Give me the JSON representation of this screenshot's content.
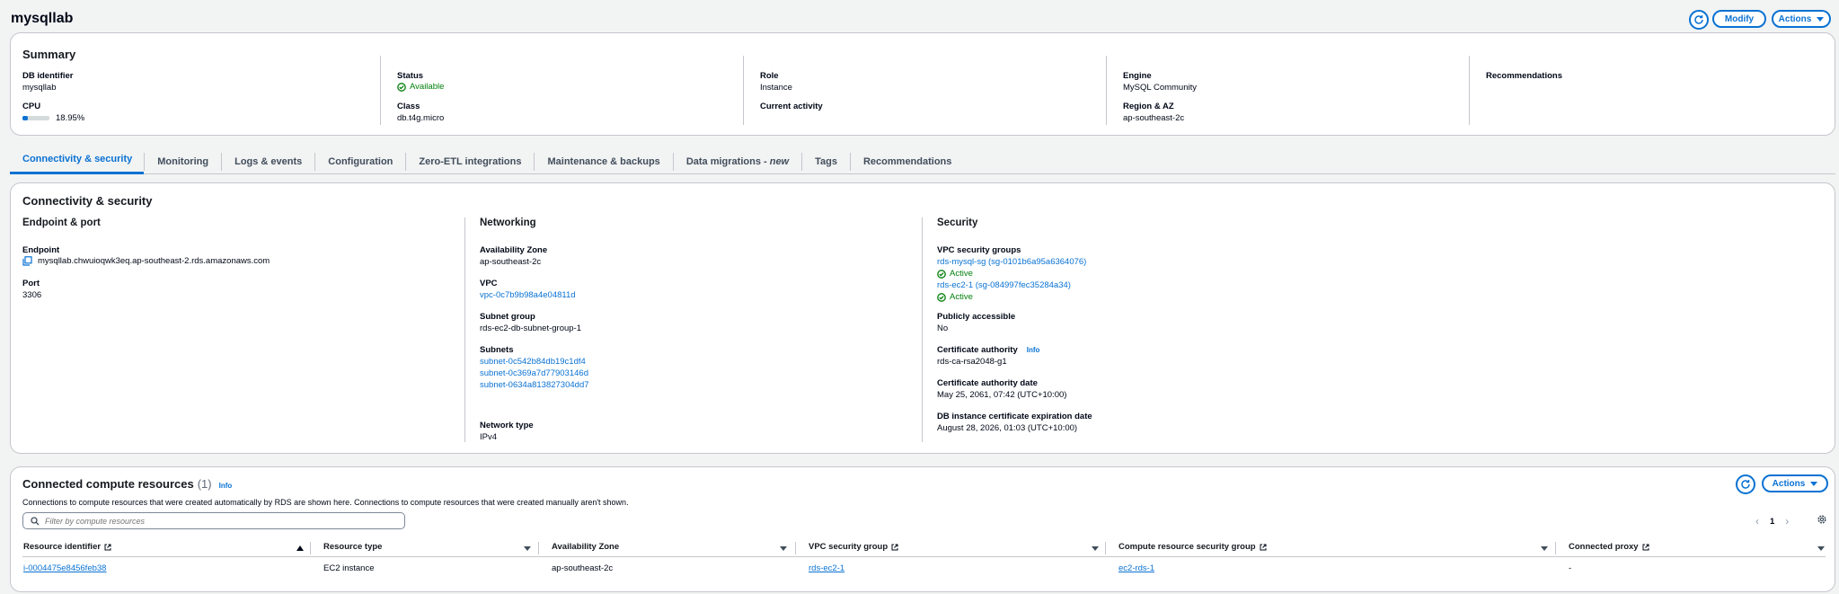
{
  "page": {
    "title": "mysqllab"
  },
  "header_actions": {
    "modify": "Modify",
    "actions": "Actions"
  },
  "summary": {
    "title": "Summary",
    "db_identifier_label": "DB identifier",
    "db_identifier": "mysqllab",
    "cpu_label": "CPU",
    "cpu_value": "18.95%",
    "cpu_fraction": 0.1895,
    "status_label": "Status",
    "status": "Available",
    "class_label": "Class",
    "class": "db.t4g.micro",
    "role_label": "Role",
    "role": "Instance",
    "current_activity_label": "Current activity",
    "engine_label": "Engine",
    "engine": "MySQL Community",
    "region_label": "Region & AZ",
    "region": "ap-southeast-2c",
    "recommendations_label": "Recommendations"
  },
  "tabs": [
    "Connectivity & security",
    "Monitoring",
    "Logs & events",
    "Configuration",
    "Zero-ETL integrations",
    "Maintenance & backups",
    "Data migrations - ",
    "Tags",
    "Recommendations"
  ],
  "tab_new_suffix": "new",
  "connectivity": {
    "title": "Connectivity & security",
    "endpoint_port": {
      "heading": "Endpoint & port",
      "endpoint_label": "Endpoint",
      "endpoint": "mysqllab.chwuioqwk3eq.ap-southeast-2.rds.amazonaws.com",
      "port_label": "Port",
      "port": "3306"
    },
    "networking": {
      "heading": "Networking",
      "az_label": "Availability Zone",
      "az": "ap-southeast-2c",
      "vpc_label": "VPC",
      "vpc": "vpc-0c7b9b98a4e04811d",
      "subnet_group_label": "Subnet group",
      "subnet_group": "rds-ec2-db-subnet-group-1",
      "subnets_label": "Subnets",
      "subnets": [
        "subnet-0c542b84db19c1df4",
        "subnet-0c369a7d77903146d",
        "subnet-0634a813827304dd7"
      ],
      "network_type_label": "Network type",
      "network_type": "IPv4"
    },
    "security": {
      "heading": "Security",
      "vpc_sg_label": "VPC security groups",
      "sg1": "rds-mysql-sg (sg-0101b6a95a6364076)",
      "sg1_status": "Active",
      "sg2": "rds-ec2-1 (sg-084997fec35284a34)",
      "sg2_status": "Active",
      "public_label": "Publicly accessible",
      "public": "No",
      "ca_label": "Certificate authority",
      "ca_info": "Info",
      "ca": "rds-ca-rsa2048-g1",
      "ca_date_label": "Certificate authority date",
      "ca_date": "May 25, 2061, 07:42 (UTC+10:00)",
      "cert_exp_label": "DB instance certificate expiration date",
      "cert_exp": "August 28, 2026, 01:03 (UTC+10:00)"
    }
  },
  "compute": {
    "title": "Connected compute resources",
    "count": "(1)",
    "info": "Info",
    "description": "Connections to compute resources that were created automatically by RDS are shown here. Connections to compute resources that were created manually aren't shown.",
    "actions": "Actions",
    "search_placeholder": "Filter by compute resources",
    "page": "1",
    "columns": [
      "Resource identifier",
      "Resource type",
      "Availability Zone",
      "VPC security group",
      "Compute resource security group",
      "Connected proxy"
    ],
    "rows": [
      {
        "id": "i-0004475e8456feb38",
        "type": "EC2 instance",
        "az": "ap-southeast-2c",
        "vpc_sg": "rds-ec2-1",
        "compute_sg": "ec2-rds-1",
        "proxy": "-"
      }
    ]
  }
}
